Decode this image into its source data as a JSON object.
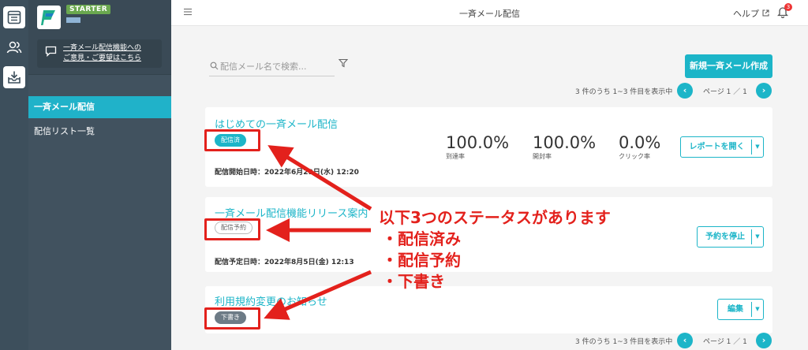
{
  "sidebar": {
    "plan_badge": "STARTER",
    "feedback_line1": "一斉メール配信機能への",
    "feedback_line2": "ご意見・ご要望はこちら",
    "nav": [
      {
        "label": "一斉メール配信",
        "active": true
      },
      {
        "label": "配信リスト一覧",
        "active": false
      }
    ]
  },
  "topbar": {
    "title": "一斉メール配信",
    "help_label": "ヘルプ",
    "notification_count": "3"
  },
  "toolbar": {
    "search_placeholder": "配信メール名で検索...",
    "new_button_label": "新規一斉メール作成"
  },
  "pagination": {
    "summary": "3 件のうち 1~3 件目を表示中",
    "page_label": "ページ 1 ／ 1",
    "prev_icon": "‹",
    "next_icon": "›"
  },
  "campaigns": [
    {
      "title": "はじめての一斉メール配信",
      "status": "配信済",
      "date": "配信開始日時：2022年6月29日(水) 12:20",
      "stats": [
        {
          "value": "100.0%",
          "label": "到達率"
        },
        {
          "value": "100.0%",
          "label": "開封率"
        },
        {
          "value": "0.0%",
          "label": "クリック率"
        }
      ],
      "action": "レポートを開く"
    },
    {
      "title": "一斉メール配信機能リリース案内",
      "status": "配信予約",
      "date": "配信予定日時：2022年8月5日(金) 12:13",
      "action": "予約を停止"
    },
    {
      "title": "利用規約変更のお知らせ",
      "status": "下書き",
      "action": "編集"
    }
  ],
  "annotation": {
    "line1": "以下3つのステータスがあります",
    "line2": "・配信済み",
    "line3": "・配信予約",
    "line4": "・下書き"
  },
  "colors": {
    "accent": "#1cb5c8",
    "sidebar": "#41525f",
    "annotation_red": "#e3211c"
  }
}
